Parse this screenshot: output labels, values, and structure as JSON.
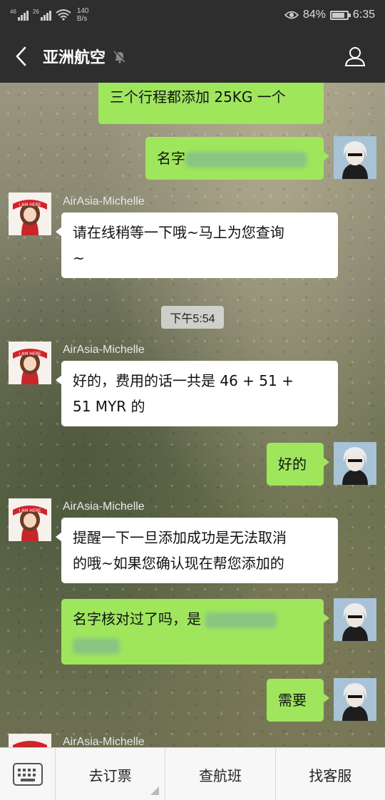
{
  "status_bar": {
    "sim1_label": "46",
    "sim2_label": "26",
    "net_speed_value": "140",
    "net_speed_unit": "B/s",
    "battery": "84%",
    "battery_level": 0.84,
    "time": "6:35"
  },
  "header": {
    "title": "亚洲航空"
  },
  "chat": {
    "time_separator": "下午5:54",
    "messages": [
      {
        "side": "right",
        "text": "三个行程都添加 25KG 一个"
      },
      {
        "side": "right",
        "text_prefix": "名字"
      },
      {
        "side": "left",
        "sender": "AirAsia-Michelle",
        "lines": [
          "请在线稍等一下哦~马上为您查询",
          "~"
        ]
      },
      {
        "side": "left",
        "sender": "AirAsia-Michelle",
        "lines": [
          "好的，费用的话一共是 46 + 51 +",
          "51 MYR 的"
        ]
      },
      {
        "side": "right",
        "text": "好的"
      },
      {
        "side": "left",
        "sender": "AirAsia-Michelle",
        "lines": [
          "提醒一下一旦添加成功是无法取消",
          "的哦~如果您确认现在帮您添加的"
        ]
      },
      {
        "side": "right",
        "text_prefix": "名字核对过了吗，是 "
      },
      {
        "side": "right",
        "text": "需要"
      },
      {
        "side": "left",
        "sender": "AirAsia-Michelle"
      }
    ]
  },
  "bottom_menu": {
    "items": [
      "去订票",
      "查航班",
      "找客服"
    ]
  },
  "colors": {
    "bar_dark": "#2e2e2e",
    "bubble_green": "#9fe65d",
    "bubble_white": "#ffffff"
  }
}
